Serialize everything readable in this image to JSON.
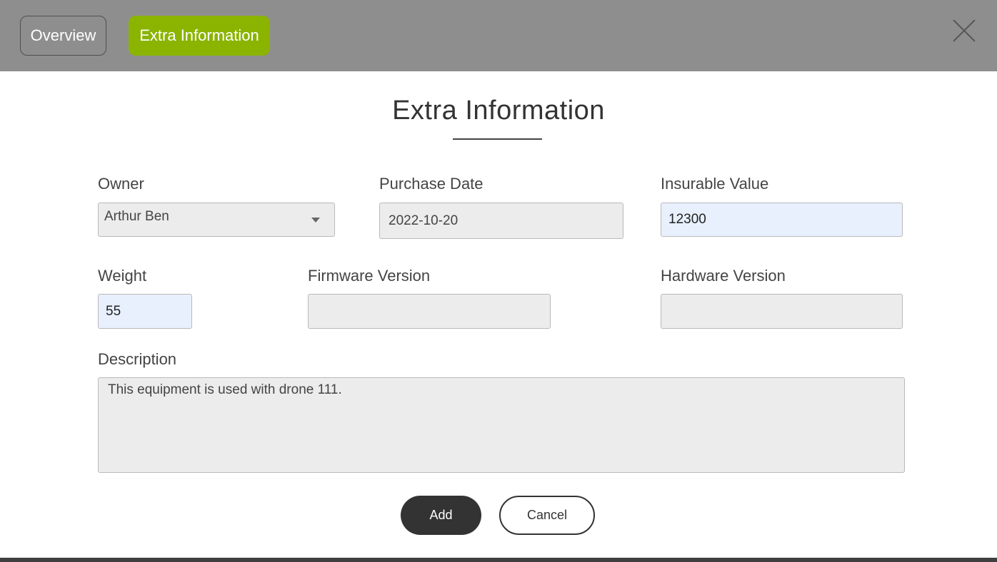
{
  "tabs": {
    "overview": "Overview",
    "extra": "Extra Information"
  },
  "title": "Extra Information",
  "form": {
    "owner": {
      "label": "Owner",
      "value": "Arthur Ben"
    },
    "purchase_date": {
      "label": "Purchase Date",
      "value": "2022-10-20"
    },
    "insurable_value": {
      "label": "Insurable Value",
      "value": "12300"
    },
    "weight": {
      "label": "Weight",
      "value": "55"
    },
    "firmware_version": {
      "label": "Firmware Version",
      "value": ""
    },
    "hardware_version": {
      "label": "Hardware Version",
      "value": ""
    },
    "description": {
      "label": "Description",
      "value": "This equipment is used with drone 111."
    }
  },
  "buttons": {
    "add": "Add",
    "cancel": "Cancel"
  },
  "colors": {
    "active_tab": "#8ab400",
    "autofill": "#e8f0fe",
    "primary_button": "#333333"
  }
}
